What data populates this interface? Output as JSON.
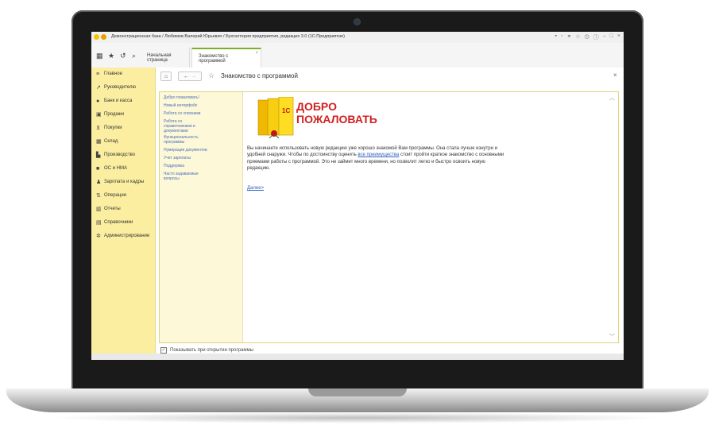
{
  "window": {
    "title": "Демонстрационная база / Любимов Валерий Юрьевич / Бухгалтерия предприятия, редакция 3.0  (1С:Предприятие)"
  },
  "tabs": [
    {
      "label": "Начальная страница"
    },
    {
      "label": "Знакомство с программой"
    }
  ],
  "sidebar": {
    "items": [
      {
        "label": "Главное",
        "icon": "menu-icon"
      },
      {
        "label": "Руководителю",
        "icon": "chart-icon"
      },
      {
        "label": "Банк и касса",
        "icon": "bank-icon"
      },
      {
        "label": "Продажи",
        "icon": "bag-icon"
      },
      {
        "label": "Покупки",
        "icon": "cart-icon"
      },
      {
        "label": "Склад",
        "icon": "warehouse-icon"
      },
      {
        "label": "Производство",
        "icon": "factory-icon"
      },
      {
        "label": "ОС и НМА",
        "icon": "assets-icon"
      },
      {
        "label": "Зарплата и кадры",
        "icon": "person-icon"
      },
      {
        "label": "Операции",
        "icon": "operations-icon"
      },
      {
        "label": "Отчеты",
        "icon": "report-icon"
      },
      {
        "label": "Справочники",
        "icon": "book-icon"
      },
      {
        "label": "Администрирование",
        "icon": "gear-icon"
      }
    ]
  },
  "form": {
    "title": "Знакомство с программой",
    "close": "×"
  },
  "help_nav": [
    "Добро пожаловать!",
    "Новый интерфейс",
    "Работа со списками",
    "Работа со справочниками и документами",
    "Функциональность программы",
    "Нумерация документов",
    "Учет зарплаты",
    "Поддержка",
    "Часто задаваемые вопросы"
  ],
  "welcome": {
    "logo_text": "1С",
    "heading_line1": "ДОБРО",
    "heading_line2": "ПОЖАЛОВАТЬ",
    "text_before_link": "Вы начинаете использовать новую редакцию уже хорошо знакомой Вам программы. Она стала лучше изнутри и удобней снаружи. Чтобы по достоинству оценить ",
    "link": "все преимущества",
    "text_after_link": " стоит пройти краткое знакомство с основными приемами работы с программой. Это не займет много времени, но позволит легко и быстро освоить новую редакцию.",
    "next_link": "Далее>"
  },
  "footer": {
    "checkbox_checked": true,
    "checkbox_label": "Показывать при открытии программы"
  },
  "colors": {
    "sidebar_bg": "#fbeea0",
    "accent_red": "#d12020",
    "link_blue": "#3060c0",
    "logo_yellow": "#f5c400"
  }
}
